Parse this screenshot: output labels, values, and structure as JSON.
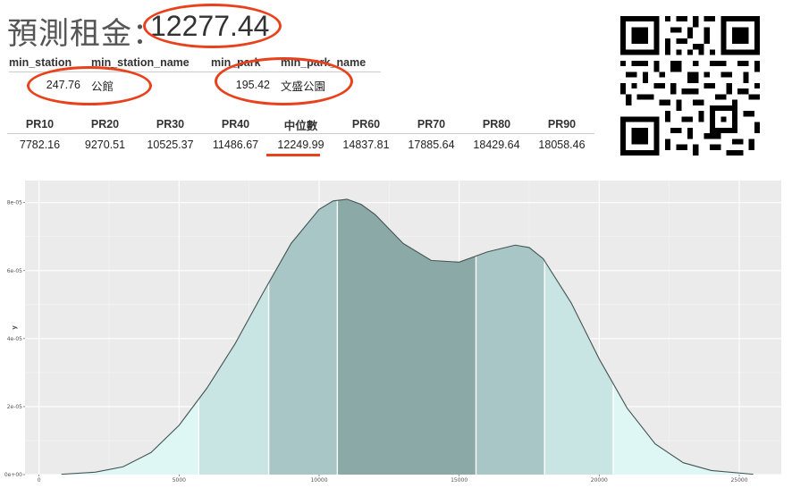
{
  "header": {
    "label": "預測租金：",
    "value": "12277.44"
  },
  "nearest_table": {
    "columns": [
      "min_station",
      "min_station_name",
      "min_park",
      "min_park_name"
    ],
    "row": [
      "247.76",
      "公館",
      "195.42",
      "文盛公園"
    ]
  },
  "percentile_table": {
    "columns": [
      "PR10",
      "PR20",
      "PR30",
      "PR40",
      "中位數",
      "PR60",
      "PR70",
      "PR80",
      "PR90"
    ],
    "row": [
      "7782.16",
      "9270.51",
      "10525.37",
      "11486.67",
      "12249.99",
      "14837.81",
      "17885.64",
      "18429.64",
      "18058.46"
    ]
  },
  "qr_code": {
    "icon": "qr-code-icon"
  },
  "chart_data": {
    "type": "area",
    "ylabel": "y",
    "x_ticks": [
      "0",
      "5000",
      "10000",
      "15000",
      "20000",
      "25000"
    ],
    "y_ticks": [
      "0e+00",
      "2e-05",
      "4e-05",
      "6e-05",
      "8e-05"
    ],
    "xlim": [
      -500,
      26500
    ],
    "ylim": [
      0,
      8.65e-05
    ],
    "density": {
      "x": [
        800,
        2000,
        3000,
        4000,
        5000,
        6000,
        7000,
        8000,
        9000,
        10000,
        10500,
        11000,
        11500,
        12000,
        13000,
        14000,
        15000,
        16000,
        17000,
        17500,
        18000,
        19000,
        20000,
        21000,
        22000,
        23000,
        24000,
        25500
      ],
      "y": [
        1e-07,
        7e-07,
        2.3e-06,
        6.5e-06,
        1.45e-05,
        2.55e-05,
        3.85e-05,
        5.35e-05,
        6.8e-05,
        7.8e-05,
        8.05e-05,
        8.1e-05,
        7.95e-05,
        7.65e-05,
        6.8e-05,
        6.3e-05,
        6.25e-05,
        6.55e-05,
        6.75e-05,
        6.68e-05,
        6.35e-05,
        5.05e-05,
        3.4e-05,
        1.95e-05,
        9e-06,
        3.5e-06,
        1.2e-06,
        1e-07
      ]
    },
    "bands": [
      {
        "from": 800,
        "to": 5700,
        "color": "#def7f5"
      },
      {
        "from": 5700,
        "to": 8200,
        "color": "#c8e4e3"
      },
      {
        "from": 8200,
        "to": 10650,
        "color": "#a7c6c5"
      },
      {
        "from": 10650,
        "to": 15600,
        "color": "#8ba9a6"
      },
      {
        "from": 15600,
        "to": 18050,
        "color": "#a7c6c5"
      },
      {
        "from": 18050,
        "to": 20500,
        "color": "#c8e4e3"
      },
      {
        "from": 20500,
        "to": 25500,
        "color": "#def7f5"
      }
    ],
    "band_lines": [
      5700,
      8200,
      10650,
      15600,
      18050,
      20500
    ],
    "grid": true,
    "panel_bg": "#ebebeb"
  }
}
